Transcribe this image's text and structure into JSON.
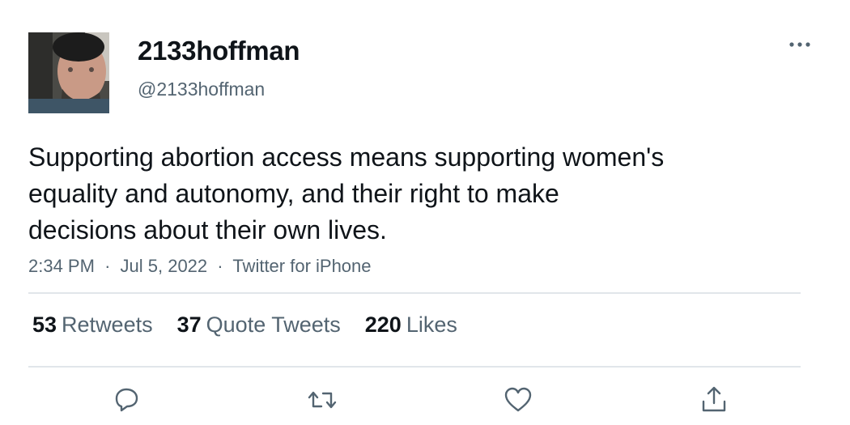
{
  "author": {
    "display_name": "2133hoffman",
    "handle": "@2133hoffman",
    "avatar_icon": "profile-photo"
  },
  "tweet": {
    "text_lines": [
      "Supporting abortion access means supporting women's",
      "equality and autonomy, and their right to make",
      "decisions about their own lives."
    ],
    "time": "2:34 PM",
    "date": "Jul 5, 2022",
    "source": "Twitter for iPhone",
    "separator": "·"
  },
  "stats": {
    "retweets": {
      "count": "53",
      "label": "Retweets"
    },
    "quote_tweets": {
      "count": "37",
      "label": "Quote Tweets"
    },
    "likes": {
      "count": "220",
      "label": "Likes"
    }
  },
  "actions": [
    {
      "name": "reply",
      "icon": "reply-icon"
    },
    {
      "name": "retweet",
      "icon": "retweet-icon"
    },
    {
      "name": "like",
      "icon": "heart-icon"
    },
    {
      "name": "share",
      "icon": "share-icon"
    }
  ],
  "colors": {
    "text_primary": "#0f1419",
    "text_secondary": "#536471",
    "divider": "#e1e6ea"
  }
}
